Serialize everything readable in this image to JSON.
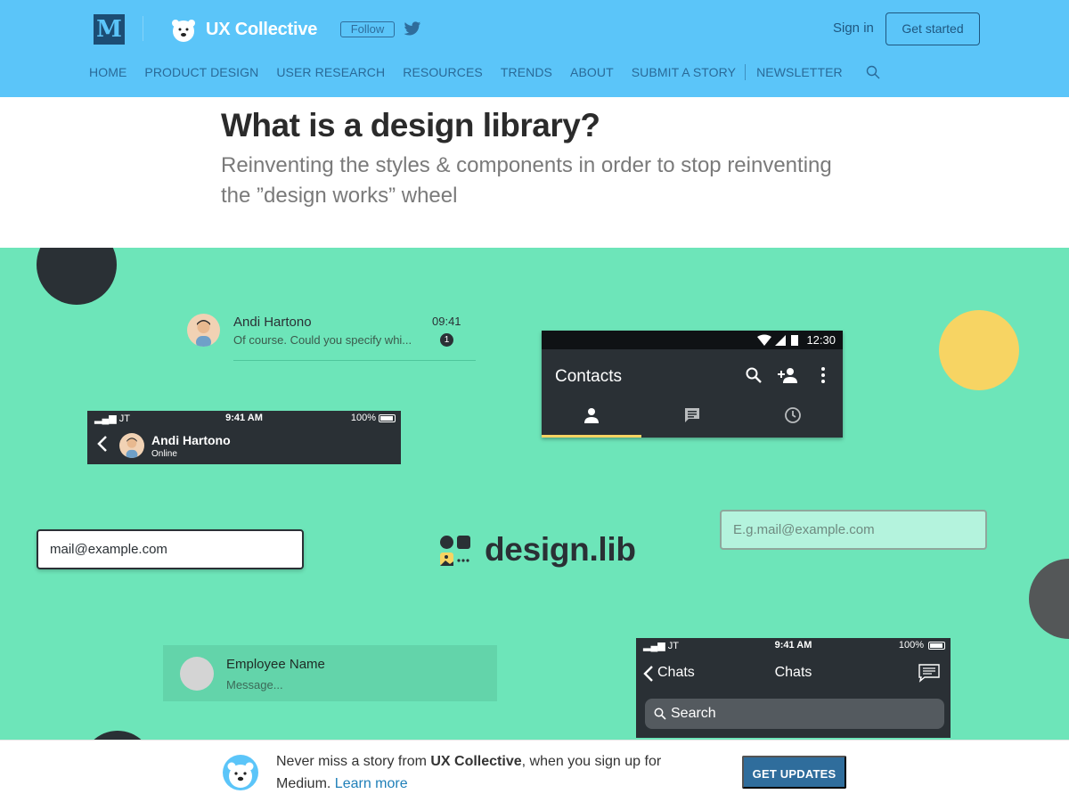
{
  "header": {
    "medium_logo": "M",
    "publication_name": "UX Collective",
    "follow_label": "Follow",
    "signin_label": "Sign in",
    "getstarted_label": "Get started",
    "nav": [
      "HOME",
      "PRODUCT DESIGN",
      "USER RESEARCH",
      "RESOURCES",
      "TRENDS",
      "ABOUT",
      "SUBMIT A STORY",
      "NEWSLETTER"
    ],
    "icons": [
      "medium-icon",
      "polar-bear-icon",
      "twitter-icon",
      "search-icon"
    ],
    "colors": {
      "bar": "#5bc5f9",
      "nav_text": "#2a6a98"
    }
  },
  "article": {
    "title": "What is a design library?",
    "subtitle": "Reinventing the styles & components in order to stop reinventing the ”design works” wheel"
  },
  "hero": {
    "background": "#6de5b9",
    "chat_item": {
      "name": "Andi Hartono",
      "time": "09:41",
      "message": "Of course. Could you specify whi...",
      "badge": "1"
    },
    "ios_profile_bar": {
      "carrier": "JT",
      "time": "9:41 AM",
      "battery": "100%",
      "name": "Andi Hartono",
      "status": "Online"
    },
    "android_bar": {
      "time": "12:30",
      "title": "Contacts",
      "tabs": [
        "person-icon",
        "message-icon",
        "clock-icon"
      ],
      "accent": "#f7d463"
    },
    "input_filled": {
      "value": "mail@example.com"
    },
    "input_placeholder": {
      "placeholder": "E.g.mail@example.com"
    },
    "brand": {
      "name": "design.lib"
    },
    "employee_card": {
      "name": "Employee Name",
      "message": "Message..."
    },
    "ios_chats_bar": {
      "carrier": "JT",
      "time": "9:41 AM",
      "battery": "100%",
      "back_label": "Chats",
      "title": "Chats",
      "search_label": "Search"
    }
  },
  "banner": {
    "text_prefix": "Never miss a story from ",
    "publication": "UX Collective",
    "text_suffix": ", when you sign up for Medium. ",
    "learn_more": "Learn more",
    "cta_label": "GET UPDATES"
  }
}
